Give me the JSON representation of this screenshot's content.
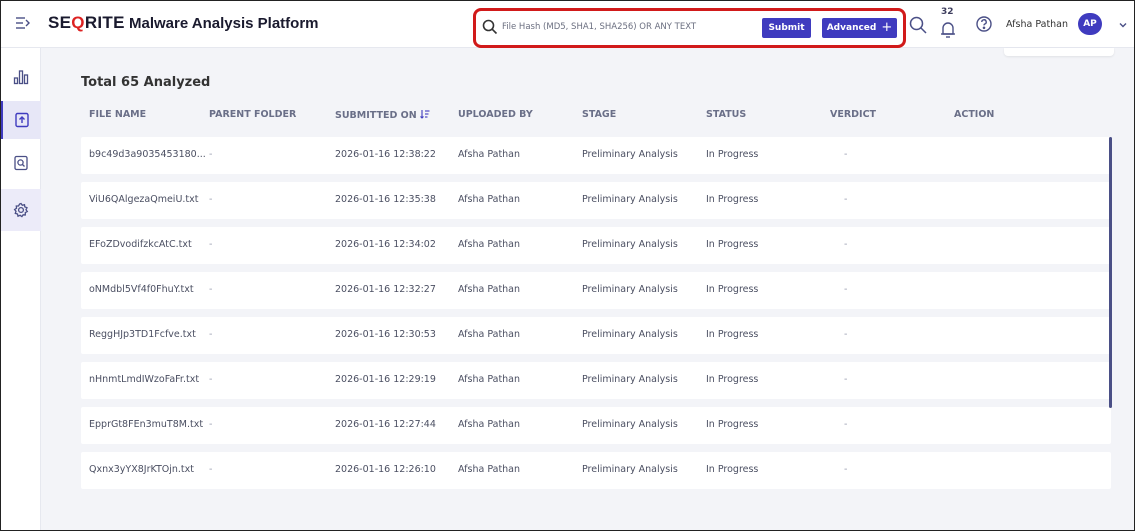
{
  "header": {
    "logo_text_pre": "SE",
    "logo_text_q": "Q",
    "logo_text_post": "RITE",
    "app_title": "Malware Analysis Platform",
    "search_placeholder": "File Hash (MD5, SHA1, SHA256) OR ANY TEXT",
    "submit_label": "Submit",
    "advanced_label": "Advanced",
    "advanced_plus": "+",
    "notification_count": "32",
    "user_name": "Afsha Pathan",
    "user_initials": "AP"
  },
  "colors": {
    "accent": "#3f3bbf",
    "highlight_border": "#d11a1a",
    "page_bg": "#f3f4f8",
    "sidebar_icon": "#4a4f86"
  },
  "sidebar": {
    "items": [
      {
        "icon": "bar-chart-icon"
      },
      {
        "icon": "upload-file-icon",
        "active": true
      },
      {
        "icon": "search-document-icon"
      },
      {
        "icon": "settings-gear-icon"
      }
    ]
  },
  "main": {
    "title": "Total 65 Analyzed",
    "columns": [
      "FILE NAME",
      "PARENT FOLDER",
      "SUBMITTED ON",
      "UPLOADED BY",
      "STAGE",
      "STATUS",
      "VERDICT",
      "ACTION"
    ],
    "rows": [
      {
        "file_name": "b9c49d3a9035453180...",
        "parent_folder": "-",
        "submitted_on": "2026-01-16 12:38:22",
        "uploaded_by": "Afsha Pathan",
        "stage": "Preliminary Analysis",
        "status": "In Progress",
        "verdict": "-"
      },
      {
        "file_name": "ViU6QAlgezaQmeiU.txt",
        "parent_folder": "-",
        "submitted_on": "2026-01-16 12:35:38",
        "uploaded_by": "Afsha Pathan",
        "stage": "Preliminary Analysis",
        "status": "In Progress",
        "verdict": "-"
      },
      {
        "file_name": "EFoZDvodifzkcAtC.txt",
        "parent_folder": "-",
        "submitted_on": "2026-01-16 12:34:02",
        "uploaded_by": "Afsha Pathan",
        "stage": "Preliminary Analysis",
        "status": "In Progress",
        "verdict": "-"
      },
      {
        "file_name": "oNMdbl5Vf4f0FhuY.txt",
        "parent_folder": "-",
        "submitted_on": "2026-01-16 12:32:27",
        "uploaded_by": "Afsha Pathan",
        "stage": "Preliminary Analysis",
        "status": "In Progress",
        "verdict": "-"
      },
      {
        "file_name": "ReggHJp3TD1Fcfve.txt",
        "parent_folder": "-",
        "submitted_on": "2026-01-16 12:30:53",
        "uploaded_by": "Afsha Pathan",
        "stage": "Preliminary Analysis",
        "status": "In Progress",
        "verdict": "-"
      },
      {
        "file_name": "nHnmtLmdIWzoFaFr.txt",
        "parent_folder": "-",
        "submitted_on": "2026-01-16 12:29:19",
        "uploaded_by": "Afsha Pathan",
        "stage": "Preliminary Analysis",
        "status": "In Progress",
        "verdict": "-"
      },
      {
        "file_name": "EpprGt8FEn3muT8M.txt",
        "parent_folder": "-",
        "submitted_on": "2026-01-16 12:27:44",
        "uploaded_by": "Afsha Pathan",
        "stage": "Preliminary Analysis",
        "status": "In Progress",
        "verdict": "-"
      },
      {
        "file_name": "Qxnx3yYX8JrKTOjn.txt",
        "parent_folder": "-",
        "submitted_on": "2026-01-16 12:26:10",
        "uploaded_by": "Afsha Pathan",
        "stage": "Preliminary Analysis",
        "status": "In Progress",
        "verdict": "-"
      }
    ]
  }
}
